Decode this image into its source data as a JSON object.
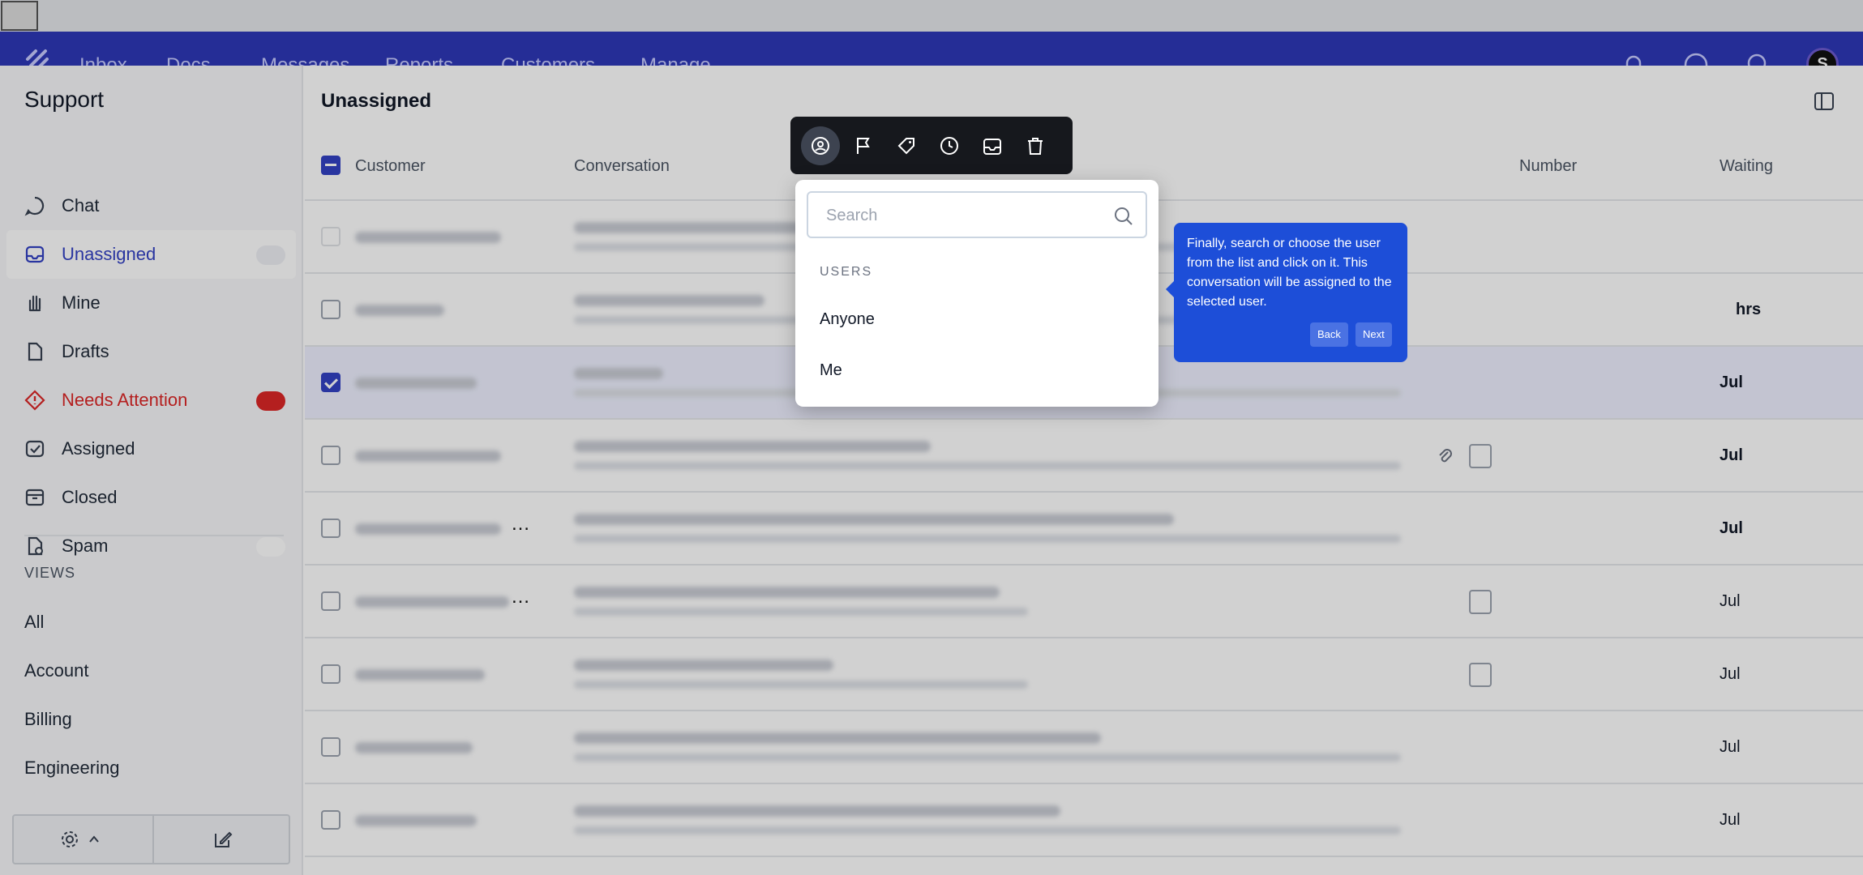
{
  "nav": {
    "items": [
      "Inbox",
      "Docs",
      "Messages",
      "Reports",
      "Customers",
      "Manage"
    ],
    "avatar_initial": "S",
    "icons": [
      "bell-icon",
      "help-icon",
      "search-icon"
    ],
    "color": "#2e37b8"
  },
  "sidebar": {
    "title": "Support",
    "items": [
      {
        "label": "Chat",
        "icon": "chat-icon"
      },
      {
        "label": "Unassigned",
        "icon": "inbox-icon",
        "active": true
      },
      {
        "label": "Mine",
        "icon": "hand-icon"
      },
      {
        "label": "Drafts",
        "icon": "draft-icon"
      },
      {
        "label": "Needs Attention",
        "icon": "alert-icon",
        "alert": true
      },
      {
        "label": "Assigned",
        "icon": "assigned-icon"
      },
      {
        "label": "Closed",
        "icon": "archive-icon"
      },
      {
        "label": "Spam",
        "icon": "spam-icon"
      }
    ],
    "views_heading": "VIEWS",
    "views": [
      "All",
      "Account",
      "Billing",
      "Engineering"
    ]
  },
  "main": {
    "title": "Unassigned",
    "columns": {
      "customer": "Customer",
      "conversation": "Conversation",
      "number": "Number",
      "waiting": "Waiting"
    },
    "rows": [
      {
        "waiting": "",
        "selected": false
      },
      {
        "waiting": "hrs",
        "selected": false
      },
      {
        "waiting": "Jul",
        "selected": true
      },
      {
        "waiting": "Jul",
        "selected": false
      },
      {
        "waiting": "Jul",
        "selected": false
      },
      {
        "waiting": "Jul",
        "selected": false
      },
      {
        "waiting": "Jul",
        "selected": false
      },
      {
        "waiting": "Jul",
        "selected": false
      },
      {
        "waiting": "Jul",
        "selected": false
      }
    ]
  },
  "toolbar": {
    "buttons": [
      "assign-icon",
      "flag-icon",
      "tag-icon",
      "snooze-icon",
      "move-icon",
      "trash-icon"
    ]
  },
  "dropdown": {
    "search_placeholder": "Search",
    "section_heading": "USERS",
    "options": [
      "Anyone",
      "Me"
    ]
  },
  "tooltip": {
    "text": "Finally, search or choose the user from the list and click on it. This conversation will be assigned to the selected user.",
    "back_label": "Back",
    "next_label": "Next"
  }
}
